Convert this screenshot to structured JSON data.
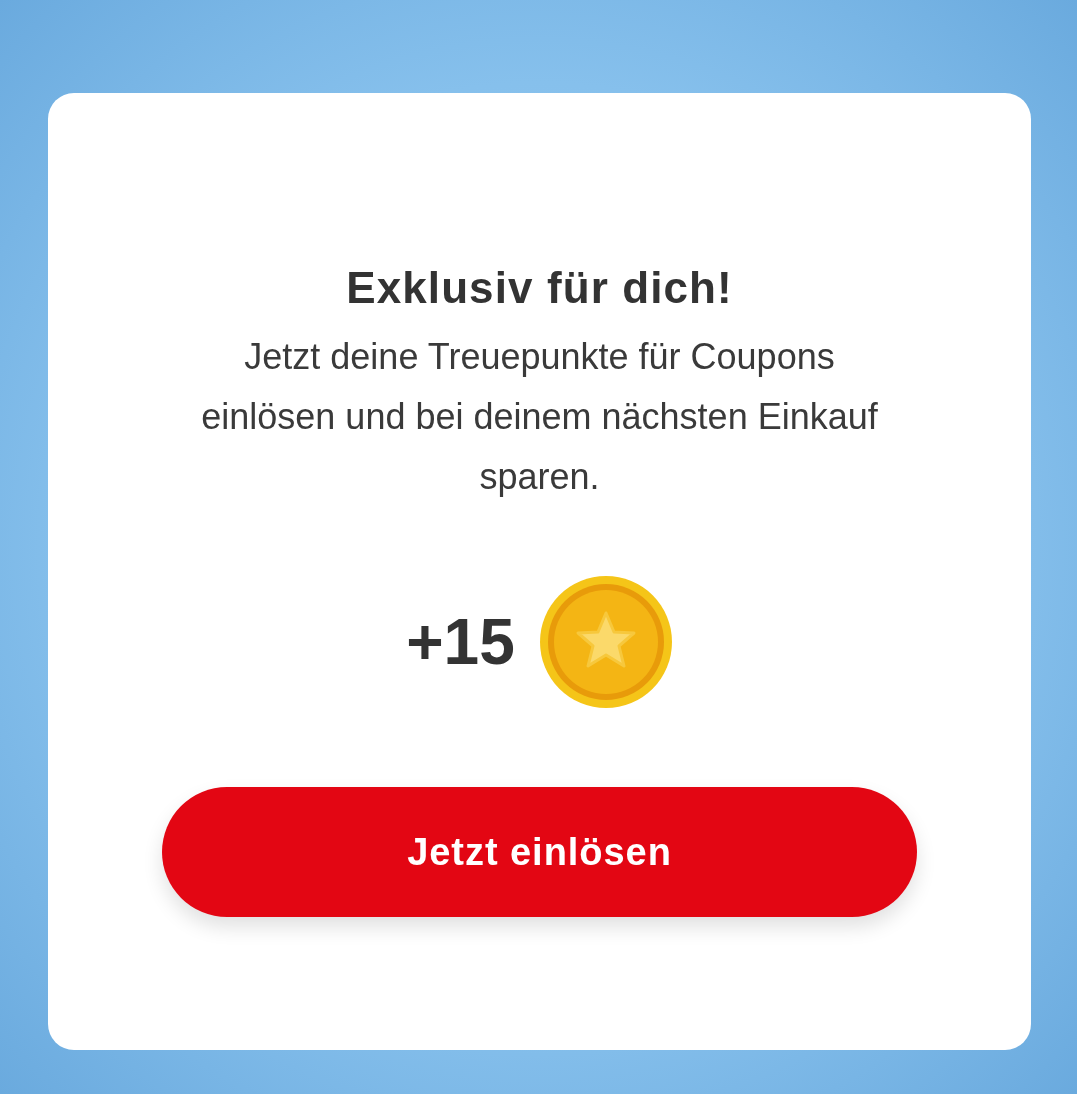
{
  "dialog": {
    "title": "Exklusiv für dich!",
    "message": "Jetzt deine Treuepunkte für Coupons einlösen und bei deinem nächsten Einkauf sparen.",
    "points": "+15",
    "button": "Jetzt einlösen"
  }
}
